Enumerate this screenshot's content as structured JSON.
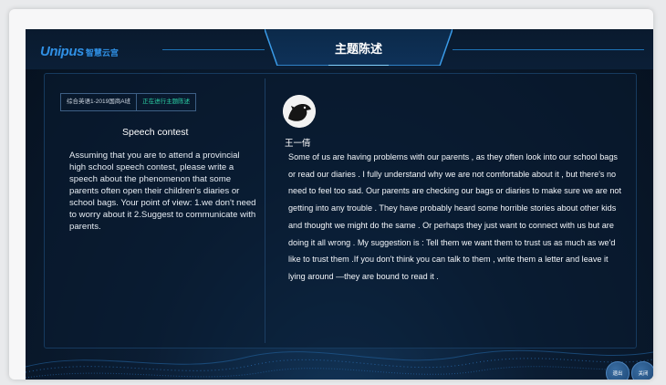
{
  "header": {
    "logo_mark": "Unipus",
    "logo_text": "智慧云宫",
    "title": "主题陈述"
  },
  "topic": {
    "class_name": "综合英语1-2019国商A班",
    "status": "正在进行主题陈述",
    "title": "Speech contest",
    "description": "Assuming that you are to attend a provincial high school speech contest, please write a speech about the phenomenon that some parents often open their children's diaries or school bags. Your point of view: 1.we don't need to worry about it 2.Suggest to communicate with parents."
  },
  "answer": {
    "author": "王一倩",
    "text": "Some of us are having problems with our parents , as they often look into our school bags or read our diaries . I fully understand why we are not comfortable about it , but there's no need to feel too sad. Our parents are checking our bags or diaries to make sure we are not getting into any trouble . They have probably heard some horrible stories about other kids and thought we might do the same . Or perhaps they just want to connect with us but are doing it all wrong . My suggestion is : Tell them we want them to trust us as much as we'd like to trust them .If you don't think you can talk to them , write them a letter and leave it lying around —they are bound to read it ."
  },
  "buttons": {
    "exit_label": "退出",
    "close_label": "关闭"
  },
  "icons": {
    "avatar": "crow-avatar-icon"
  },
  "colors": {
    "accent": "#2f8fe3",
    "status_green": "#2bd1a6",
    "background": "#0b1d33"
  }
}
